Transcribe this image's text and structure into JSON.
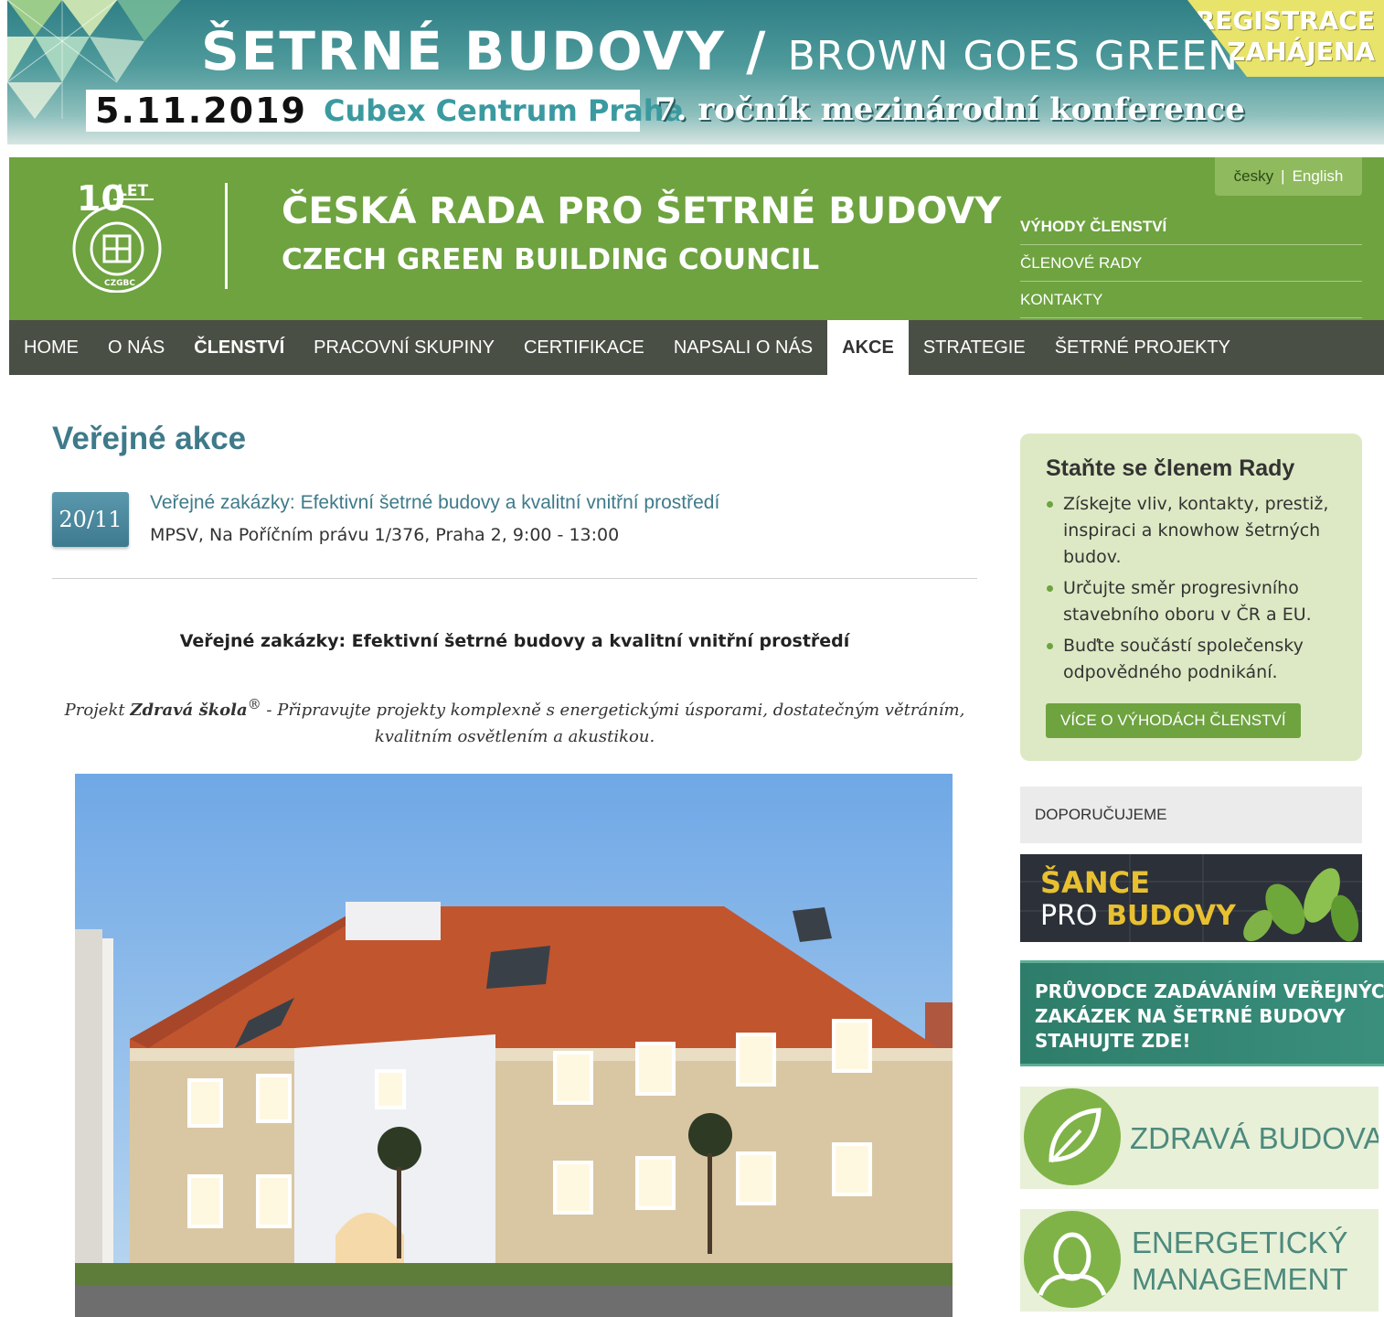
{
  "banner": {
    "title": "ŠETRNÉ BUDOVY /",
    "subtitle": "BROWN GOES GREEN",
    "date": "5.11.2019",
    "venue": "Cubex Centrum Praha",
    "edition": "7. ročník mezinárodní konference",
    "registration_line1": "REGISTRACE",
    "registration_line2": "ZAHÁJENA"
  },
  "header": {
    "logo_years": "10",
    "logo_let": "LET",
    "logo_ring_text": "ČESKÁ RADA PRO ŠETRNÉ BUDOVY",
    "logo_code": "CZGBC",
    "title_cz": "ČESKÁ RADA PRO ŠETRNÉ BUDOVY",
    "title_en": "CZECH GREEN BUILDING COUNCIL",
    "lang_cz": "česky",
    "lang_sep": "|",
    "lang_en": "English",
    "links": [
      "VÝHODY ČLENSTVÍ",
      "ČLENOVÉ RADY",
      "KONTAKTY"
    ]
  },
  "nav": {
    "items": [
      "HOME",
      "O NÁS",
      "ČLENSTVÍ",
      "PRACOVNÍ SKUPINY",
      "CERTIFIKACE",
      "NAPSALI O NÁS",
      "AKCE",
      "STRATEGIE",
      "ŠETRNÉ PROJEKTY"
    ],
    "active": "AKCE"
  },
  "main": {
    "page_title": "Veřejné akce",
    "event": {
      "date": "20/11",
      "title": "Veřejné zakázky: Efektivní šetrné budovy a kvalitní vnitřní prostředí",
      "place": "MPSV, Na Poříčním právu 1/376, Praha 2, 9:00 - 13:00"
    },
    "article_heading": "Veřejné zakázky: Efektivní šetrné budovy a kvalitní vnitřní prostředí",
    "intro_prefix": "Projekt ",
    "intro_bold": "Zdravá škola",
    "intro_reg": "®",
    "intro_text": " - Připravujte projekty komplexně s energetickými úsporami, dostatečným větráním, kvalitním osvětlením a akustikou."
  },
  "sidebar": {
    "member_title": "Staňte se členem Rady",
    "member_points": [
      "Získejte vliv, kontakty, prestiž, inspiraci a knowhow šetrných budov.",
      "Určujte směr progresivního stavebního oboru v ČR a EU.",
      "Buďte součástí společensky odpovědného podnikání."
    ],
    "member_button": "VÍCE O VÝHODÁCH ČLENSTVÍ",
    "recommend_label": "DOPORUČUJEME",
    "ad_sance_line1": "ŠANCE",
    "ad_sance_pro": "PRO",
    "ad_sance_budovy": "BUDOVY",
    "ad_pruvodce_line1": "PRŮVODCE ZADÁVÁNÍM VEŘEJNÝCH",
    "ad_pruvodce_line2": "ZAKÁZEK NA ŠETRNÉ BUDOVY",
    "ad_pruvodce_line3": "STAHUJTE ZDE!",
    "ad_zdrava": "ZDRAVÁ BUDOVA",
    "ad_energ_line1": "ENERGETICKÝ",
    "ad_energ_line2": "MANAGEMENT"
  },
  "colors": {
    "header_green": "#6ea340",
    "nav_dark": "#4a4f45",
    "link_teal": "#3e7a8a",
    "member_box_bg": "#dde9c4"
  }
}
